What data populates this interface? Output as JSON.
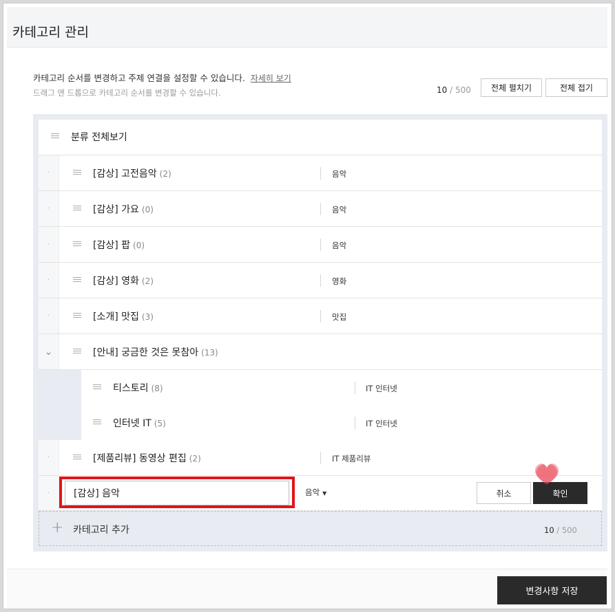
{
  "header": {
    "title": "카테고리 관리"
  },
  "intro": {
    "line1": "카테고리 순서를 변경하고 주제 연결을 설정할 수 있습니다.",
    "detail_link": "자세히 보기",
    "line2": "드래그 앤 드롭으로 카테고리 순서를 변경할 수 있습니다."
  },
  "counter": {
    "current": "10",
    "max": "/ 500"
  },
  "toolbar": {
    "expand_all": "전체 펼치기",
    "collapse_all": "전체 접기"
  },
  "root": {
    "label": "분류 전체보기"
  },
  "categories": [
    {
      "name": "[감상] 고전음악",
      "count": "(2)",
      "subject": "음악",
      "toggle": "·"
    },
    {
      "name": "[감상] 가요",
      "count": "(0)",
      "subject": "음악",
      "toggle": "·"
    },
    {
      "name": "[감상] 팝",
      "count": "(0)",
      "subject": "음악",
      "toggle": "·"
    },
    {
      "name": "[감상] 영화",
      "count": "(2)",
      "subject": "영화",
      "toggle": "·"
    },
    {
      "name": "[소개] 맛집",
      "count": "(3)",
      "subject": "맛집",
      "toggle": "·"
    },
    {
      "name": "[안내] 궁금한 것은 못참아",
      "count": "(13)",
      "subject": "",
      "toggle": "⌄"
    }
  ],
  "children": [
    {
      "name": "티스토리",
      "count": "(8)",
      "subject": "IT 인터넷"
    },
    {
      "name": "인터넷 IT",
      "count": "(5)",
      "subject": "IT 인터넷"
    }
  ],
  "after_children": [
    {
      "name": "[제품리뷰] 동영상 편집",
      "count": "(2)",
      "subject": "IT 제품리뷰",
      "toggle": "·"
    }
  ],
  "edit_row": {
    "input_value": "[감상] 음악",
    "subject_selected": "음악",
    "cancel": "취소",
    "confirm": "확인",
    "toggle": "·"
  },
  "add": {
    "plus": "+",
    "label": "카테고리 추가",
    "current": "10",
    "max": "/ 500"
  },
  "footer": {
    "save": "변경사항 저장"
  },
  "colors": {
    "highlight": "#e0141a",
    "dark_button": "#2a2a2a",
    "panel_bg": "#e8ebf1",
    "heart": "#e94a5a"
  }
}
